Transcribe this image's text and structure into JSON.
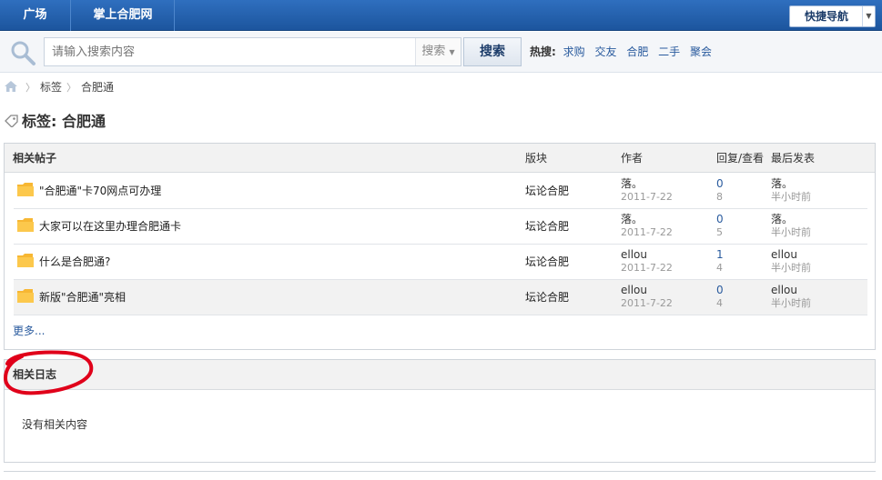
{
  "topnav": {
    "items": [
      "广场",
      "掌上合肥网"
    ],
    "quick_nav": "快捷导航"
  },
  "search": {
    "placeholder": "请输入搜索内容",
    "type": "搜索",
    "button": "搜索",
    "hot_label": "热搜:",
    "hot_terms": [
      "求购",
      "交友",
      "合肥",
      "二手",
      "聚会"
    ]
  },
  "breadcrumb": [
    "标签",
    "合肥通"
  ],
  "page_title": "标签: 合肥通",
  "threads": {
    "columns": [
      "相关帖子",
      "版块",
      "作者",
      "回复/查看",
      "最后发表"
    ],
    "rows": [
      {
        "subject": "\"合肥通\"卡70网点可办理",
        "forum": "坛论合肥",
        "author": "落。",
        "date": "2011-7-22",
        "replies": "0",
        "views": "8",
        "last_author": "落。",
        "last_time": "半小时前"
      },
      {
        "subject": "大家可以在这里办理合肥通卡",
        "forum": "坛论合肥",
        "author": "落。",
        "date": "2011-7-22",
        "replies": "0",
        "views": "5",
        "last_author": "落。",
        "last_time": "半小时前"
      },
      {
        "subject": "什么是合肥通?",
        "forum": "坛论合肥",
        "author": "ellou",
        "date": "2011-7-22",
        "replies": "1",
        "views": "4",
        "last_author": "ellou",
        "last_time": "半小时前"
      },
      {
        "subject": "新版\"合肥通\"亮相",
        "forum": "坛论合肥",
        "author": "ellou",
        "date": "2011-7-22",
        "replies": "0",
        "views": "4",
        "last_author": "ellou",
        "last_time": "半小时前"
      }
    ],
    "more": "更多..."
  },
  "blogs": {
    "title": "相关日志",
    "empty": "没有相关内容"
  },
  "colors": {
    "nav_blue": "#1c559e",
    "link": "#2a5b9e",
    "annotation": "#e0001a"
  }
}
